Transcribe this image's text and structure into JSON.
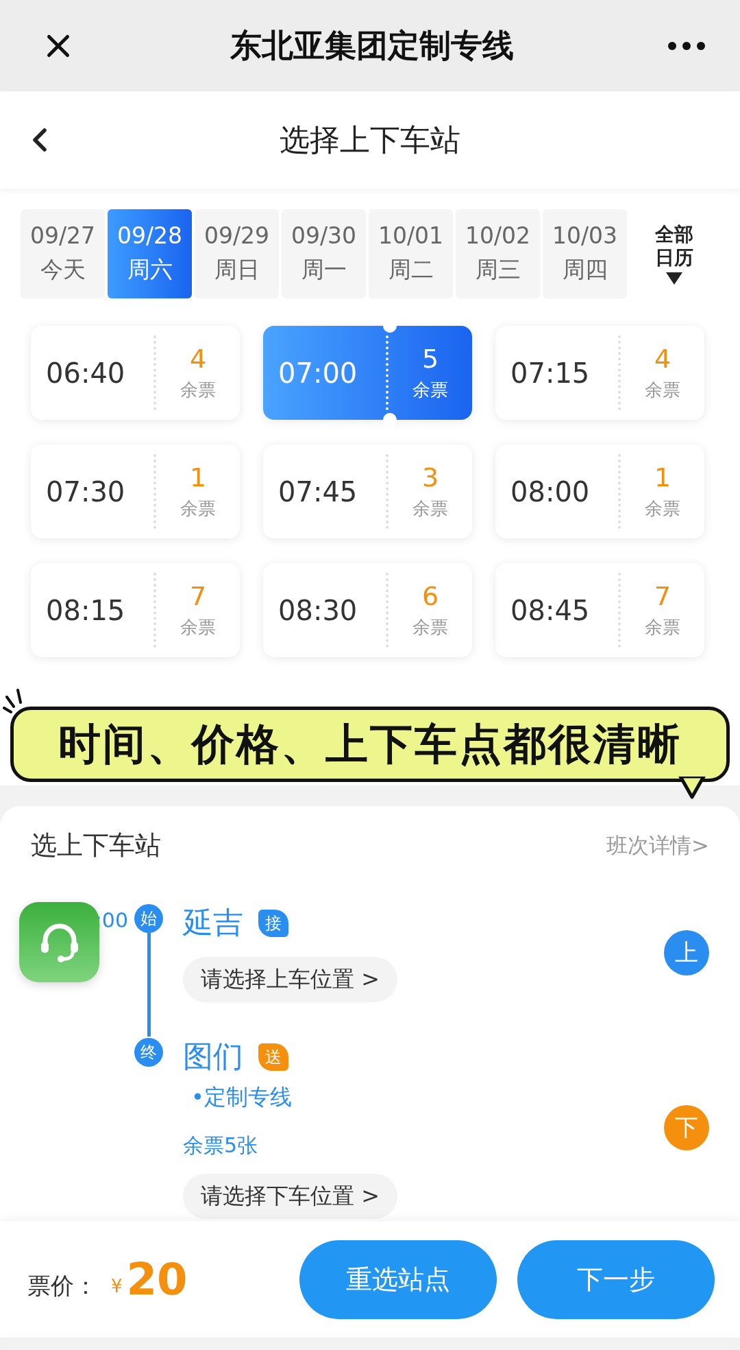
{
  "top_bar": {
    "title": "东北亚集团定制专线"
  },
  "nav": {
    "title": "选择上下车站"
  },
  "dates": [
    {
      "date": "09/27",
      "day": "今天",
      "selected": false
    },
    {
      "date": "09/28",
      "day": "周六",
      "selected": true
    },
    {
      "date": "09/29",
      "day": "周日",
      "selected": false
    },
    {
      "date": "09/30",
      "day": "周一",
      "selected": false
    },
    {
      "date": "10/01",
      "day": "周二",
      "selected": false
    },
    {
      "date": "10/02",
      "day": "周三",
      "selected": false
    },
    {
      "date": "10/03",
      "day": "周四",
      "selected": false
    }
  ],
  "calendar": {
    "label": "全部日历"
  },
  "trips": [
    {
      "time": "06:40",
      "seats": "4",
      "label": "余票",
      "selected": false
    },
    {
      "time": "07:00",
      "seats": "5",
      "label": "余票",
      "selected": true
    },
    {
      "time": "07:15",
      "seats": "4",
      "label": "余票",
      "selected": false
    },
    {
      "time": "07:30",
      "seats": "1",
      "label": "余票",
      "selected": false
    },
    {
      "time": "07:45",
      "seats": "3",
      "label": "余票",
      "selected": false
    },
    {
      "time": "08:00",
      "seats": "1",
      "label": "余票",
      "selected": false
    },
    {
      "time": "08:15",
      "seats": "7",
      "label": "余票",
      "selected": false
    },
    {
      "time": "08:30",
      "seats": "6",
      "label": "余票",
      "selected": false
    },
    {
      "time": "08:45",
      "seats": "7",
      "label": "余票",
      "selected": false
    }
  ],
  "banner": {
    "text": "时间、价格、上下车点都很清晰"
  },
  "sheet": {
    "title": "选上下车站",
    "link": "班次详情>"
  },
  "route": {
    "time": ":00",
    "stops": [
      {
        "kind": "board",
        "marker": "始",
        "name": "延吉",
        "tag": "接",
        "button": "请选择上车位置 >",
        "side": "上"
      },
      {
        "kind": "alight",
        "marker": "终",
        "name": "图们",
        "tag": "送",
        "line": "•定制专线",
        "seats": "余票5张",
        "button": "请选择下车位置 >",
        "side": "下"
      }
    ]
  },
  "footer": {
    "price_label": "票价：",
    "currency": "¥",
    "price": "20",
    "buttons": [
      "重选站点",
      "下一步"
    ]
  }
}
